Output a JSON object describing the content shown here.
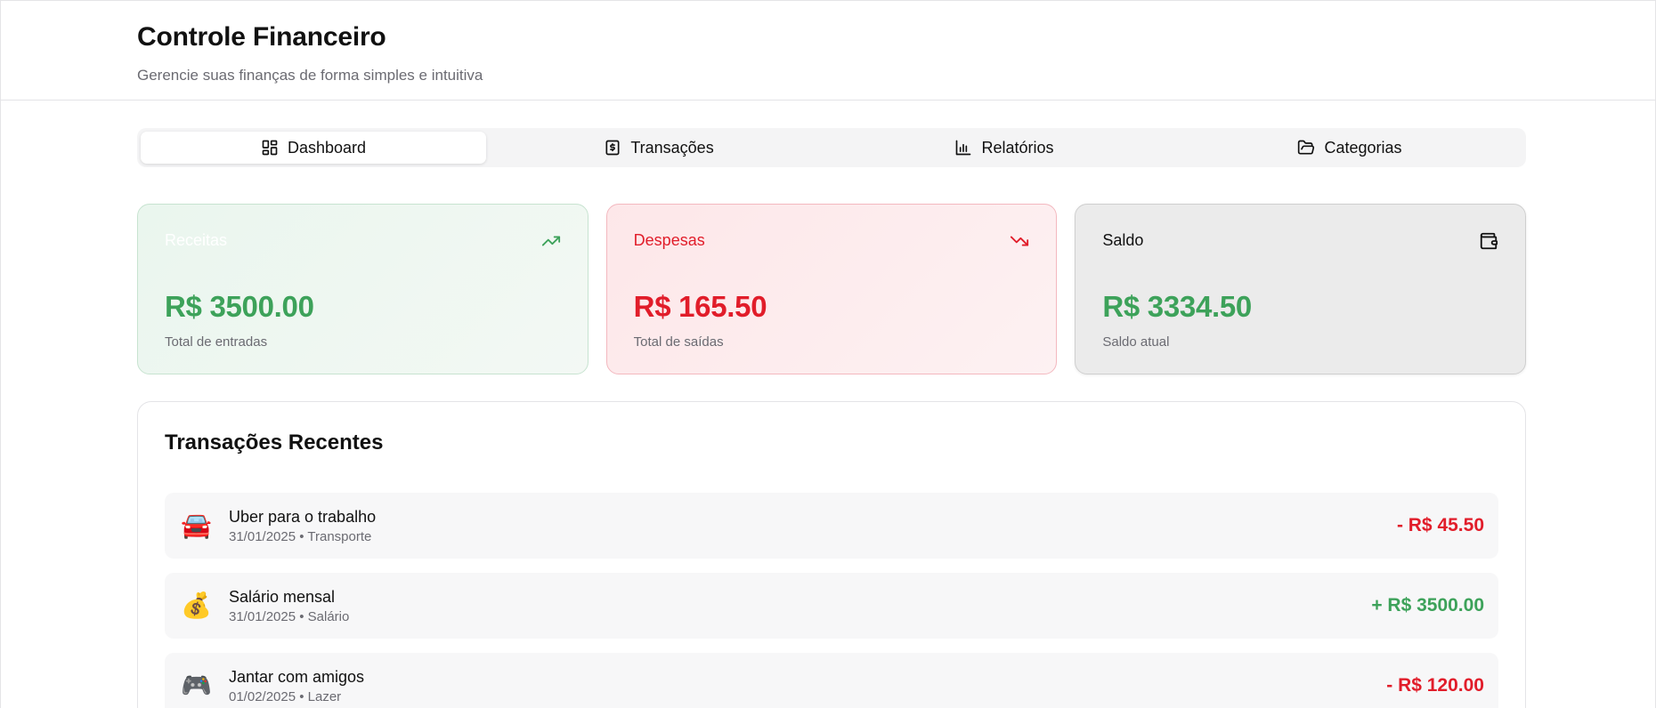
{
  "header": {
    "title": "Controle Financeiro",
    "subtitle": "Gerencie suas finanças de forma simples e intuitiva"
  },
  "tabs": [
    {
      "label": "Dashboard",
      "icon": "layout-grid-icon",
      "active": true
    },
    {
      "label": "Transações",
      "icon": "receipt-icon",
      "active": false
    },
    {
      "label": "Relatórios",
      "icon": "bar-chart-icon",
      "active": false
    },
    {
      "label": "Categorias",
      "icon": "folder-open-icon",
      "active": false
    }
  ],
  "cards": {
    "income": {
      "label": "Receitas",
      "value": "R$ 3500.00",
      "caption": "Total de entradas",
      "icon": "trending-up-icon"
    },
    "expense": {
      "label": "Despesas",
      "value": "R$ 165.50",
      "caption": "Total de saídas",
      "icon": "trending-down-icon"
    },
    "balance": {
      "label": "Saldo",
      "value": "R$ 3334.50",
      "caption": "Saldo atual",
      "icon": "wallet-icon"
    }
  },
  "recent": {
    "title": "Transações Recentes",
    "items": [
      {
        "emoji": "🚘",
        "description": "Uber para o trabalho",
        "meta": "31/01/2025 • Transporte",
        "amount": "- R$ 45.50",
        "type": "expense"
      },
      {
        "emoji": "💰",
        "description": "Salário mensal",
        "meta": "31/01/2025 • Salário",
        "amount": "+ R$ 3500.00",
        "type": "income"
      },
      {
        "emoji": "🎮",
        "description": "Jantar com amigos",
        "meta": "01/02/2025 • Lazer",
        "amount": "- R$ 120.00",
        "type": "expense"
      }
    ]
  },
  "colors": {
    "income": "#3da25a",
    "expense": "#e11d2a",
    "text": "#111111",
    "muted": "#6b6b72"
  }
}
